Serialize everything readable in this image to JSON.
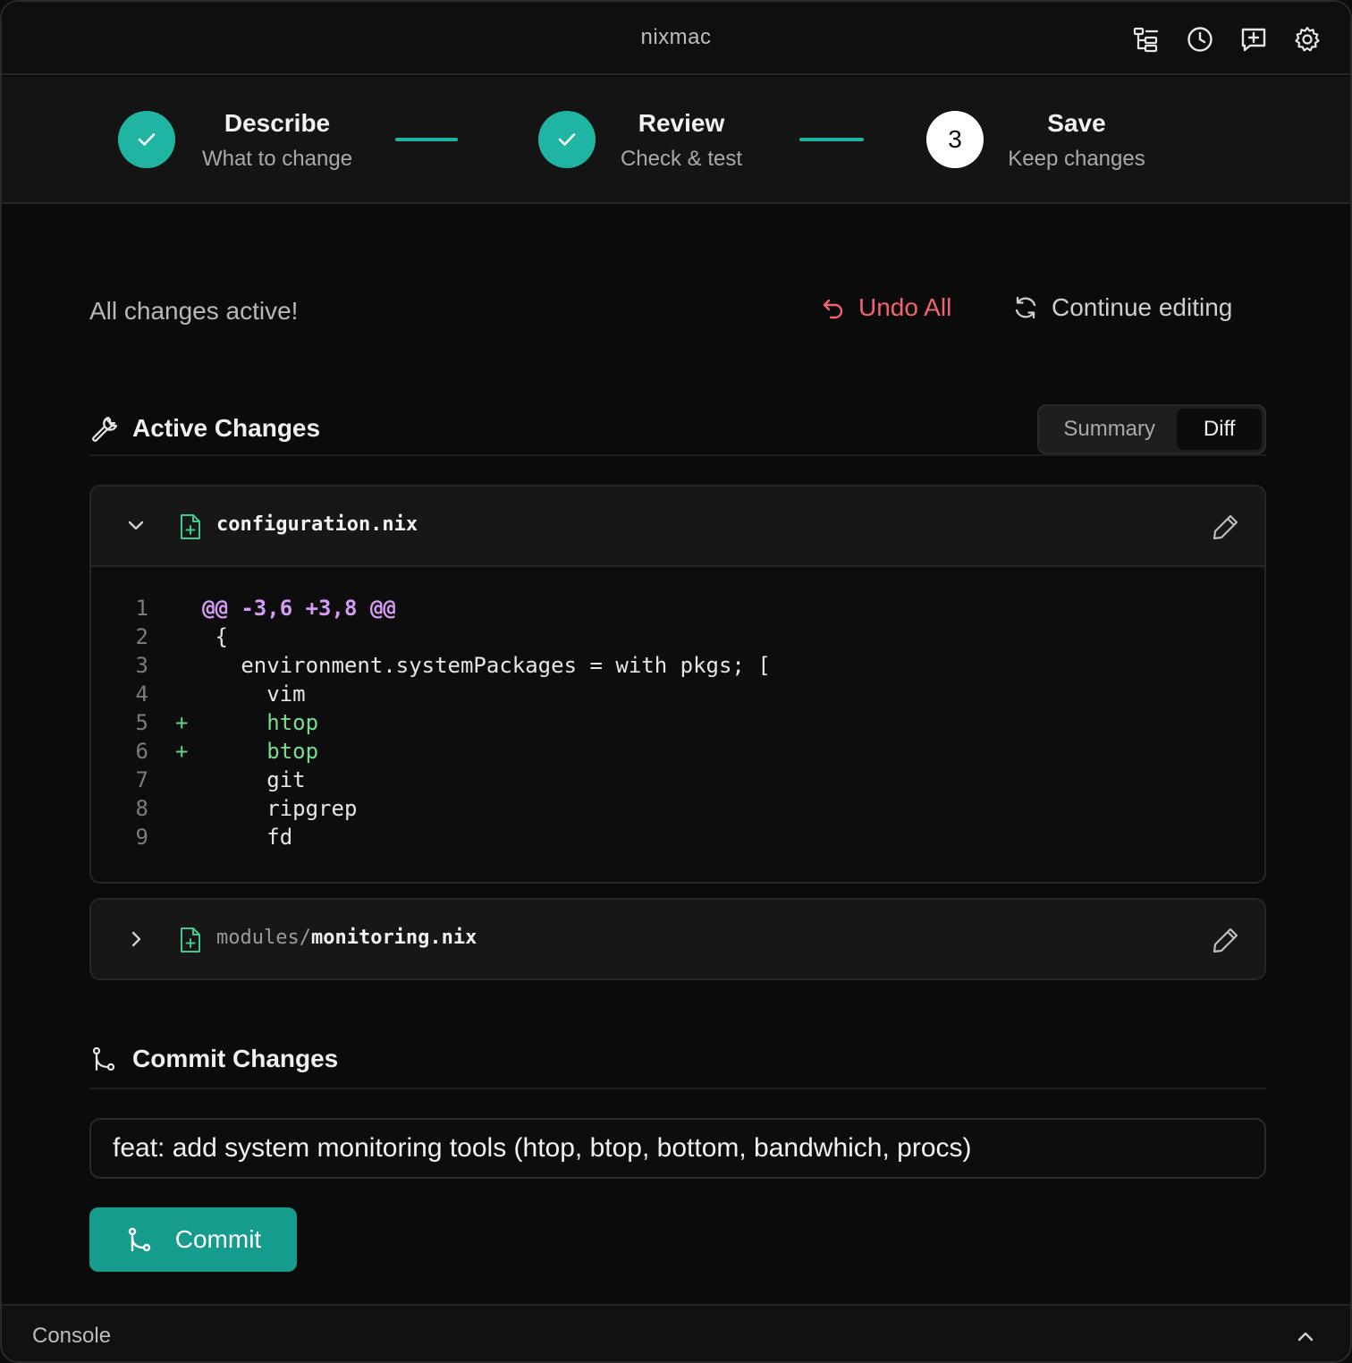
{
  "window": {
    "title": "nixmac"
  },
  "toolbar_icons": [
    "file-tree-icon",
    "history-icon",
    "new-message-icon",
    "settings-icon"
  ],
  "stepper": {
    "steps": [
      {
        "title": "Describe",
        "subtitle": "What to change",
        "state": "done"
      },
      {
        "title": "Review",
        "subtitle": "Check & test",
        "state": "done"
      },
      {
        "title": "Save",
        "subtitle": "Keep changes",
        "state": "current",
        "number": "3"
      }
    ]
  },
  "status": {
    "message": "All changes active!",
    "undo_label": "Undo All",
    "continue_label": "Continue editing"
  },
  "active_changes": {
    "title": "Active Changes",
    "view_toggle": {
      "options": [
        "Summary",
        "Diff"
      ],
      "selected": "Diff"
    },
    "files": [
      {
        "dir": "",
        "name": "configuration.nix",
        "expanded": true,
        "lines": [
          {
            "n": "1",
            "mark": "",
            "text": "@@ -3,6 +3,8 @@",
            "kind": "hunk"
          },
          {
            "n": "2",
            "mark": "",
            "text": " {",
            "kind": "ctx"
          },
          {
            "n": "3",
            "mark": "",
            "text": "   environment.systemPackages = with pkgs; [",
            "kind": "ctx"
          },
          {
            "n": "4",
            "mark": "",
            "text": "     vim",
            "kind": "ctx"
          },
          {
            "n": "5",
            "mark": "+",
            "text": "     htop",
            "kind": "add"
          },
          {
            "n": "6",
            "mark": "+",
            "text": "     btop",
            "kind": "add"
          },
          {
            "n": "7",
            "mark": "",
            "text": "     git",
            "kind": "ctx"
          },
          {
            "n": "8",
            "mark": "",
            "text": "     ripgrep",
            "kind": "ctx"
          },
          {
            "n": "9",
            "mark": "",
            "text": "     fd",
            "kind": "ctx"
          }
        ]
      },
      {
        "dir": "modules/",
        "name": "monitoring.nix",
        "expanded": false,
        "lines": []
      }
    ]
  },
  "commit": {
    "title": "Commit Changes",
    "message": "feat: add system monitoring tools (htop, btop, bottom, bandwhich, procs)",
    "button_label": "Commit"
  },
  "console": {
    "label": "Console"
  },
  "colors": {
    "accent": "#1fb5a2",
    "button": "#169c8c",
    "danger": "#f0646e",
    "hunk": "#d59cf5",
    "added": "#79dd8f"
  }
}
